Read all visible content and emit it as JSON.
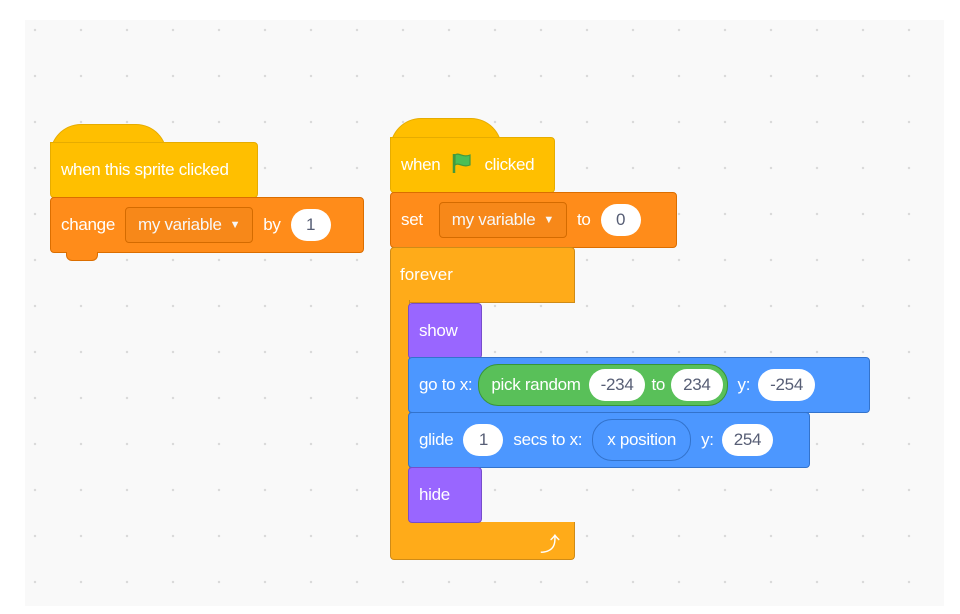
{
  "workspace": {
    "background": "#f9f9f9"
  },
  "script1": {
    "hat": {
      "label": "when this sprite clicked",
      "category": "events",
      "color": "#ffbf00"
    },
    "change": {
      "label": "change",
      "variable": "my variable",
      "by_label": "by",
      "value": "1",
      "category": "variables",
      "color": "#ff8c1a"
    }
  },
  "script2": {
    "hat": {
      "when_label": "when",
      "flag_icon": "green-flag-icon",
      "clicked_label": "clicked",
      "color": "#ffbf00"
    },
    "set": {
      "label": "set",
      "variable": "my variable",
      "to_label": "to",
      "value": "0",
      "color": "#ff8c1a"
    },
    "forever": {
      "label": "forever",
      "loop_icon": "loop-arrow-icon",
      "color": "#ffab19"
    },
    "show": {
      "label": "show",
      "color": "#9966ff"
    },
    "goto": {
      "label": "go to x:",
      "random_label": "pick random",
      "from": "-234",
      "to_label": "to",
      "to": "234",
      "y_label": "y:",
      "y": "-254",
      "color": "#4c97ff",
      "operator_color": "#59c059"
    },
    "glide": {
      "label": "glide",
      "secs": "1",
      "secs_label": "secs to x:",
      "x_reporter": "x position",
      "y_label": "y:",
      "y": "254",
      "color": "#4c97ff"
    },
    "hide": {
      "label": "hide",
      "color": "#9966ff"
    }
  }
}
